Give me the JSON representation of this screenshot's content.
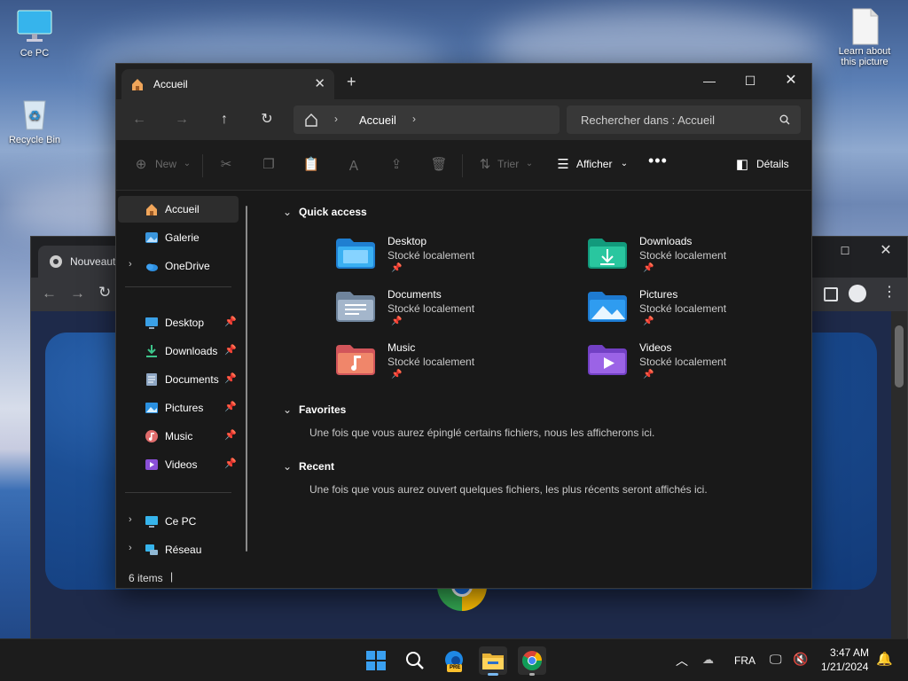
{
  "desktop": {
    "icons": [
      {
        "label": "Ce PC"
      },
      {
        "label": "Recycle Bin"
      },
      {
        "label": "Learn about this picture"
      }
    ]
  },
  "chrome": {
    "tab_title": "Nouveaut"
  },
  "explorer": {
    "tab_title": "Accueil",
    "breadcrumb": "Accueil",
    "search_placeholder": "Rechercher dans : Accueil",
    "commands": {
      "new": "New",
      "sort": "Trier",
      "view": "Afficher",
      "details": "Détails"
    },
    "sidebar": {
      "top": [
        {
          "label": "Accueil"
        },
        {
          "label": "Galerie"
        },
        {
          "label": "OneDrive"
        }
      ],
      "pinned": [
        {
          "label": "Desktop"
        },
        {
          "label": "Downloads"
        },
        {
          "label": "Documents"
        },
        {
          "label": "Pictures"
        },
        {
          "label": "Music"
        },
        {
          "label": "Videos"
        }
      ],
      "bottom": [
        {
          "label": "Ce PC"
        },
        {
          "label": "Réseau"
        }
      ]
    },
    "quick_access": {
      "title": "Quick access",
      "items": [
        {
          "name": "Desktop",
          "sub": "Stocké localement"
        },
        {
          "name": "Downloads",
          "sub": "Stocké localement"
        },
        {
          "name": "Documents",
          "sub": "Stocké localement"
        },
        {
          "name": "Pictures",
          "sub": "Stocké localement"
        },
        {
          "name": "Music",
          "sub": "Stocké localement"
        },
        {
          "name": "Videos",
          "sub": "Stocké localement"
        }
      ]
    },
    "favorites": {
      "title": "Favorites",
      "message": "Une fois que vous aurez épinglé certains fichiers, nous les afficherons ici."
    },
    "recent": {
      "title": "Recent",
      "message": "Une fois que vous aurez ouvert quelques fichiers, les plus récents seront affichés ici."
    },
    "status": "6 items"
  },
  "taskbar": {
    "language": "FRA",
    "time": "3:47 AM",
    "date": "1/21/2024",
    "edge_badge": "PRE"
  }
}
